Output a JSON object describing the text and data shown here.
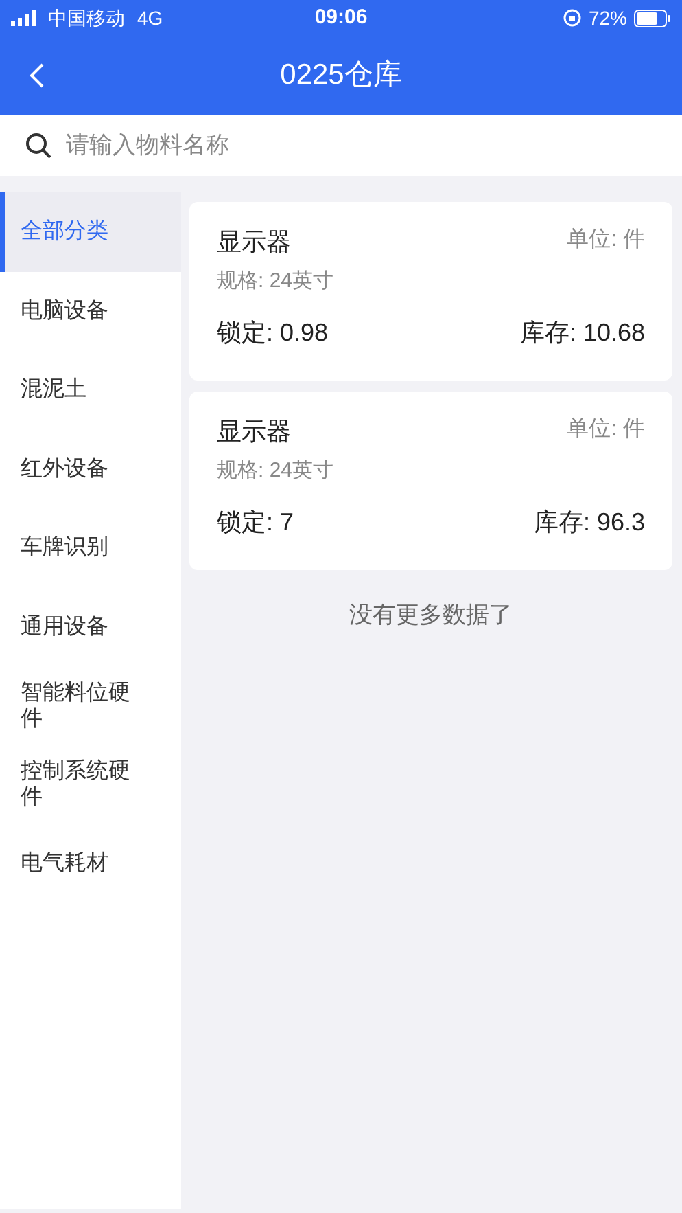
{
  "status_bar": {
    "carrier": "中国移动",
    "network": "4G",
    "time": "09:06",
    "battery": "72%"
  },
  "nav": {
    "title": "0225仓库"
  },
  "search": {
    "placeholder": "请输入物料名称"
  },
  "categories": [
    {
      "label": "全部分类",
      "selected": true
    },
    {
      "label": "电脑设备",
      "selected": false
    },
    {
      "label": "混泥土",
      "selected": false
    },
    {
      "label": "红外设备",
      "selected": false
    },
    {
      "label": "车牌识别",
      "selected": false
    },
    {
      "label": "通用设备",
      "selected": false
    },
    {
      "label": "智能料位硬件",
      "selected": false
    },
    {
      "label": "控制系统硬件",
      "selected": false
    },
    {
      "label": "电气耗材",
      "selected": false
    }
  ],
  "items": [
    {
      "name": "显示器",
      "unit": "单位: 件",
      "spec": "规格: 24英寸",
      "locked": "锁定: 0.98",
      "stock": "库存: 10.68"
    },
    {
      "name": "显示器",
      "unit": "单位: 件",
      "spec": "规格: 24英寸",
      "locked": "锁定: 7",
      "stock": "库存: 96.3"
    }
  ],
  "footer": "没有更多数据了"
}
